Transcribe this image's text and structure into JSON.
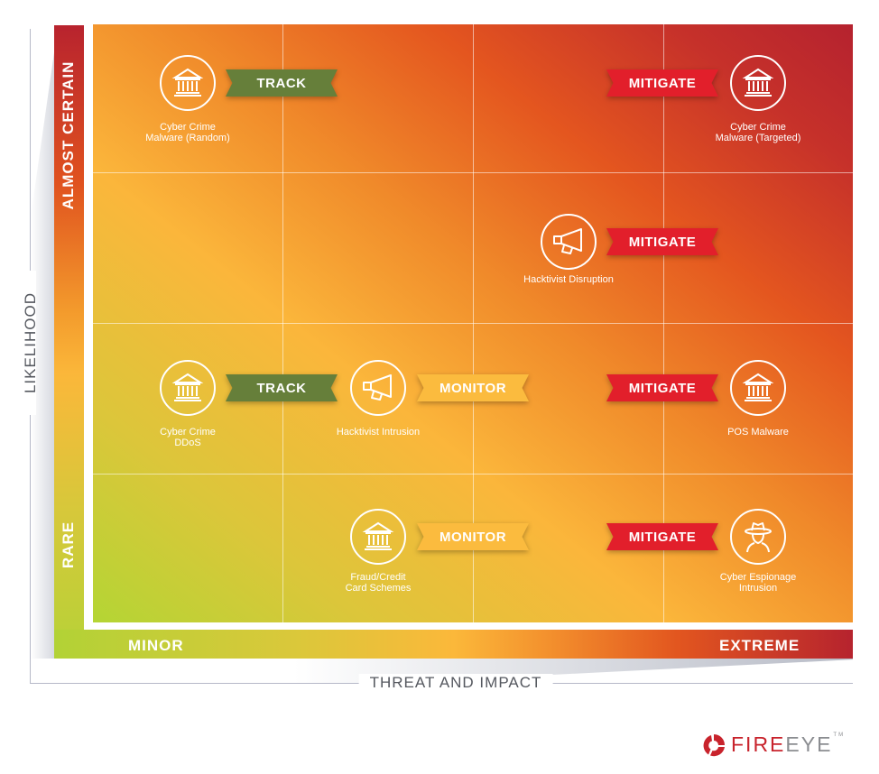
{
  "axes": {
    "y_title": "LIKELIHOOD",
    "y_high": "ALMOST CERTAIN",
    "y_low": "RARE",
    "x_title": "THREAT AND IMPACT",
    "x_low": "MINOR",
    "x_high": "EXTREME"
  },
  "grid": {
    "columns": 4,
    "rows": 4
  },
  "colors": {
    "track": "#667f3a",
    "monitor": "#fbbb3e",
    "mitigate": "#e21f2b",
    "low_risk": "#b4d534",
    "high_risk": "#b5222f"
  },
  "items": [
    {
      "label": "Cyber Crime\nMalware (Random)",
      "icon": "bank-icon",
      "action": "TRACK",
      "impact_col": 1,
      "likelihood_row": 4
    },
    {
      "label": "Cyber Crime\nMalware (Targeted)",
      "icon": "bank-icon",
      "action": "MITIGATE",
      "impact_col": 4,
      "likelihood_row": 4
    },
    {
      "label": "Hacktivist Disruption",
      "icon": "megaphone-icon",
      "action": "MITIGATE",
      "impact_col": 3,
      "likelihood_row": 3
    },
    {
      "label": "Cyber Crime\nDDoS",
      "icon": "bank-icon",
      "action": "TRACK",
      "impact_col": 1,
      "likelihood_row": 2
    },
    {
      "label": "Hacktivist Intrusion",
      "icon": "megaphone-icon",
      "action": "MONITOR",
      "impact_col": 2,
      "likelihood_row": 2
    },
    {
      "label": "POS Malware",
      "icon": "bank-icon",
      "action": "MITIGATE",
      "impact_col": 4,
      "likelihood_row": 2
    },
    {
      "label": "Fraud/Credit\nCard Schemes",
      "icon": "bank-icon",
      "action": "MONITOR",
      "impact_col": 2,
      "likelihood_row": 1
    },
    {
      "label": "Cyber Espionage\nIntrusion",
      "icon": "spy-icon",
      "action": "MITIGATE",
      "impact_col": 4,
      "likelihood_row": 1
    }
  ],
  "logo": {
    "fire": "FIRE",
    "eye": "EYE",
    "tm": "TM"
  }
}
